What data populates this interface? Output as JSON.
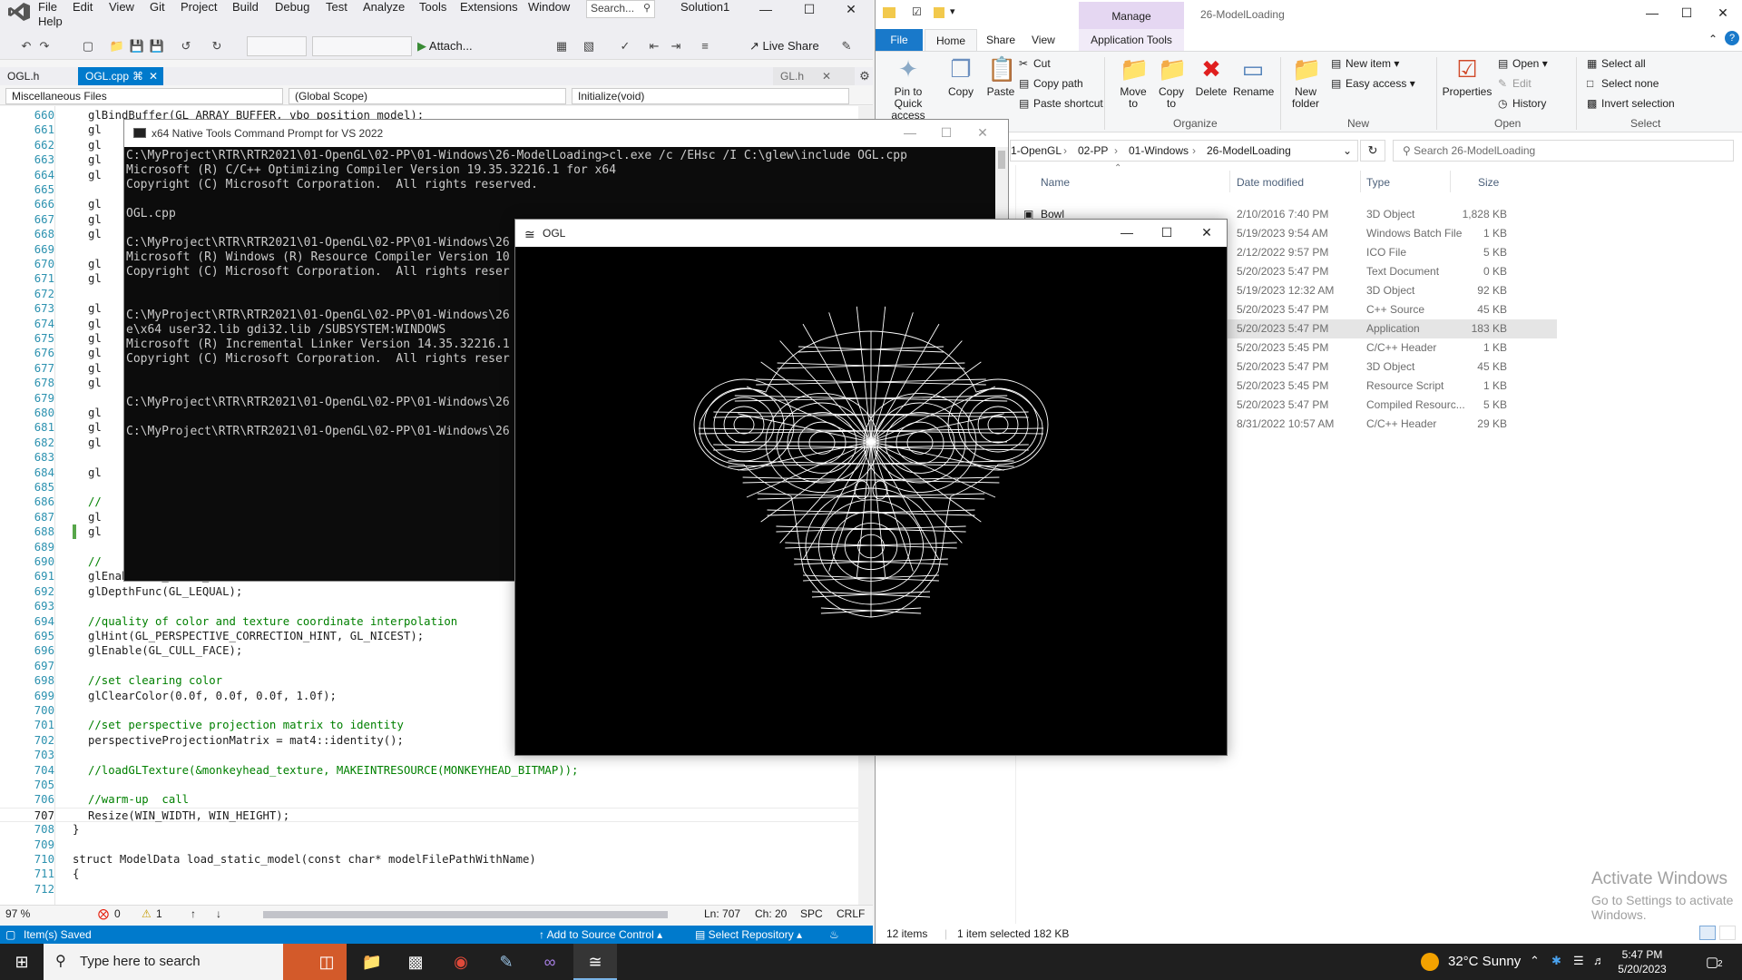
{
  "vs": {
    "menu": [
      "File",
      "Edit",
      "View",
      "Git",
      "Project",
      "Build",
      "Debug",
      "Test",
      "Analyze",
      "Tools",
      "Extensions",
      "Window",
      "Help"
    ],
    "search_placeholder": "Search...",
    "solution": "Solution1",
    "attach_label": "Attach...",
    "liveshare_label": "Live Share",
    "tabs": [
      {
        "label": "OGL.h"
      },
      {
        "label": "OGL.cpp"
      },
      {
        "label": "GL.h"
      }
    ],
    "nav": {
      "project": "Miscellaneous Files",
      "scope": "(Global Scope)",
      "member": "Initialize(void)"
    },
    "code_lines": [
      {
        "n": "660",
        "t": "glBindBuffer(GL_ARRAY_BUFFER, vbo_position_model);",
        "c": ""
      },
      {
        "n": "661",
        "t": "gl",
        "c": ""
      },
      {
        "n": "662",
        "t": "gl",
        "c": ""
      },
      {
        "n": "663",
        "t": "gl",
        "c": ""
      },
      {
        "n": "664",
        "t": "gl",
        "c": ""
      },
      {
        "n": "665",
        "t": "",
        "c": ""
      },
      {
        "n": "666",
        "t": "gl",
        "c": ""
      },
      {
        "n": "667",
        "t": "gl",
        "c": ""
      },
      {
        "n": "668",
        "t": "gl",
        "c": ""
      },
      {
        "n": "669",
        "t": "",
        "c": ""
      },
      {
        "n": "670",
        "t": "gl",
        "c": ""
      },
      {
        "n": "671",
        "t": "gl",
        "c": ""
      },
      {
        "n": "672",
        "t": "",
        "c": ""
      },
      {
        "n": "673",
        "t": "gl",
        "c": ""
      },
      {
        "n": "674",
        "t": "gl",
        "c": ""
      },
      {
        "n": "675",
        "t": "gl",
        "c": ""
      },
      {
        "n": "676",
        "t": "gl",
        "c": ""
      },
      {
        "n": "677",
        "t": "gl",
        "c": ""
      },
      {
        "n": "678",
        "t": "gl",
        "c": ""
      },
      {
        "n": "679",
        "t": "",
        "c": ""
      },
      {
        "n": "680",
        "t": "gl",
        "c": ""
      },
      {
        "n": "681",
        "t": "gl",
        "c": ""
      },
      {
        "n": "682",
        "t": "gl",
        "c": ""
      },
      {
        "n": "683",
        "t": "",
        "c": ""
      },
      {
        "n": "684",
        "t": "gl",
        "c": ""
      },
      {
        "n": "685",
        "t": "",
        "c": ""
      },
      {
        "n": "686",
        "t": "//",
        "c": "cm"
      },
      {
        "n": "687",
        "t": "gl",
        "c": ""
      },
      {
        "n": "688",
        "t": "gl",
        "c": ""
      },
      {
        "n": "689",
        "t": "",
        "c": ""
      },
      {
        "n": "690",
        "t": "//",
        "c": "cm"
      },
      {
        "n": "691",
        "t": "glEnable(GL_DEPTH_TEST);",
        "c": ""
      },
      {
        "n": "692",
        "t": "glDepthFunc(GL_LEQUAL);",
        "c": ""
      },
      {
        "n": "693",
        "t": "",
        "c": ""
      },
      {
        "n": "694",
        "t": "//quality of color and texture coordinate interpolation",
        "c": "cm"
      },
      {
        "n": "695",
        "t": "glHint(GL_PERSPECTIVE_CORRECTION_HINT, GL_NICEST);",
        "c": ""
      },
      {
        "n": "696",
        "t": "glEnable(GL_CULL_FACE);",
        "c": ""
      },
      {
        "n": "697",
        "t": "",
        "c": ""
      },
      {
        "n": "698",
        "t": "//set clearing color",
        "c": "cm"
      },
      {
        "n": "699",
        "t": "glClearColor(0.0f, 0.0f, 0.0f, 1.0f);",
        "c": ""
      },
      {
        "n": "700",
        "t": "",
        "c": ""
      },
      {
        "n": "701",
        "t": "//set perspective projection matrix to identity",
        "c": "cm"
      },
      {
        "n": "702",
        "t": "perspectiveProjectionMatrix = mat4::identity();",
        "c": ""
      },
      {
        "n": "703",
        "t": "",
        "c": ""
      },
      {
        "n": "704",
        "t": "//loadGLTexture(&monkeyhead_texture, MAKEINTRESOURCE(MONKEYHEAD_BITMAP));",
        "c": "cm"
      },
      {
        "n": "705",
        "t": "",
        "c": ""
      },
      {
        "n": "706",
        "t": "//warm-up  call",
        "c": "cm"
      },
      {
        "n": "707",
        "t": "Resize(WIN_WIDTH, WIN_HEIGHT);",
        "c": ""
      },
      {
        "n": "708",
        "t": "}",
        "c": ""
      },
      {
        "n": "709",
        "t": "",
        "c": ""
      },
      {
        "n": "710",
        "t": "struct ModelData load_static_model(const char* modelFilePathWithName)",
        "c": ""
      },
      {
        "n": "711",
        "t": "{",
        "c": ""
      },
      {
        "n": "712",
        "t": "",
        "c": ""
      }
    ],
    "status_strip": {
      "zoom": "97 %",
      "errors": "0",
      "warnings": "1",
      "ln": "Ln: 707",
      "ch": "Ch: 20",
      "spc": "SPC",
      "crlf": "CRLF"
    },
    "statusbar": {
      "message": "Item(s) Saved",
      "source_control": "Add to Source Control",
      "repository": "Select Repository"
    }
  },
  "cmd": {
    "title": "x64 Native Tools Command Prompt for VS 2022",
    "lines": [
      "C:\\MyProject\\RTR\\RTR2021\\01-OpenGL\\02-PP\\01-Windows\\26-ModelLoading>cl.exe /c /EHsc /I C:\\glew\\include OGL.cpp",
      "Microsoft (R) C/C++ Optimizing Compiler Version 19.35.32216.1 for x64",
      "Copyright (C) Microsoft Corporation.  All rights reserved.",
      "",
      "OGL.cpp",
      "",
      "C:\\MyProject\\RTR\\RTR2021\\01-OpenGL\\02-PP\\01-Windows\\26",
      "Microsoft (R) Windows (R) Resource Compiler Version 10",
      "Copyright (C) Microsoft Corporation.  All rights reser",
      "",
      "",
      "C:\\MyProject\\RTR\\RTR2021\\01-OpenGL\\02-PP\\01-Windows\\26",
      "e\\x64 user32.lib gdi32.lib /SUBSYSTEM:WINDOWS",
      "Microsoft (R) Incremental Linker Version 14.35.32216.1",
      "Copyright (C) Microsoft Corporation.  All rights reser",
      "",
      "",
      "C:\\MyProject\\RTR\\RTR2021\\01-OpenGL\\02-PP\\01-Windows\\26",
      "",
      "C:\\MyProject\\RTR\\RTR2021\\01-OpenGL\\02-PP\\01-Windows\\26"
    ]
  },
  "ogl": {
    "title": "OGL"
  },
  "explorer": {
    "manage_label": "Manage",
    "window_title": "26-ModelLoading",
    "ribbon_tabs": [
      "File",
      "Home",
      "Share",
      "View",
      "Application Tools"
    ],
    "ribbon": {
      "pin": "Pin to Quick access",
      "copy": "Copy",
      "paste": "Paste",
      "cut": "Cut",
      "copy_path": "Copy path",
      "paste_shortcut": "Paste shortcut",
      "move_to": "Move to",
      "copy_to": "Copy to",
      "delete": "Delete",
      "rename": "Rename",
      "new_folder": "New folder",
      "new_item": "New item",
      "easy_access": "Easy access",
      "properties": "Properties",
      "open": "Open",
      "edit": "Edit",
      "history": "History",
      "select_all": "Select all",
      "select_none": "Select none",
      "invert_selection": "Invert selection",
      "groups": [
        "Organize",
        "New",
        "Open",
        "Select"
      ]
    },
    "breadcrumb": [
      "1-OpenGL",
      "02-PP",
      "01-Windows",
      "26-ModelLoading"
    ],
    "search_placeholder": "Search 26-ModelLoading",
    "columns": [
      "Name",
      "Date modified",
      "Type",
      "Size"
    ],
    "files": [
      {
        "name": "Bowl",
        "date": "2/10/2016 7:40 PM",
        "type": "3D Object",
        "size": "1,828 KB"
      },
      {
        "name": "",
        "date": "5/19/2023 9:54 AM",
        "type": "Windows Batch File",
        "size": "1 KB"
      },
      {
        "name": "",
        "date": "2/12/2022 9:57 PM",
        "type": "ICO File",
        "size": "5 KB"
      },
      {
        "name": "",
        "date": "5/20/2023 5:47 PM",
        "type": "Text Document",
        "size": "0 KB"
      },
      {
        "name": "",
        "date": "5/19/2023 12:32 AM",
        "type": "3D Object",
        "size": "92 KB"
      },
      {
        "name": "",
        "date": "5/20/2023 5:47 PM",
        "type": "C++ Source",
        "size": "45 KB"
      },
      {
        "name": "",
        "date": "5/20/2023 5:47 PM",
        "type": "Application",
        "size": "183 KB"
      },
      {
        "name": "",
        "date": "5/20/2023 5:45 PM",
        "type": "C/C++ Header",
        "size": "1 KB"
      },
      {
        "name": "",
        "date": "5/20/2023 5:47 PM",
        "type": "3D Object",
        "size": "45 KB"
      },
      {
        "name": "",
        "date": "5/20/2023 5:45 PM",
        "type": "Resource Script",
        "size": "1 KB"
      },
      {
        "name": "",
        "date": "5/20/2023 5:47 PM",
        "type": "Compiled Resourc...",
        "size": "5 KB"
      },
      {
        "name": "",
        "date": "8/31/2022 10:57 AM",
        "type": "C/C++ Header",
        "size": "29 KB"
      }
    ],
    "activate_title": "Activate Windows",
    "activate_sub": "Go to Settings to activate Windows.",
    "status_items": "12 items",
    "status_selected": "1 item selected  182 KB"
  },
  "taskbar": {
    "search_placeholder": "Type here to search",
    "weather": "32°C  Sunny",
    "time": "5:47 PM",
    "date": "5/20/2023",
    "notification_count": "2"
  }
}
